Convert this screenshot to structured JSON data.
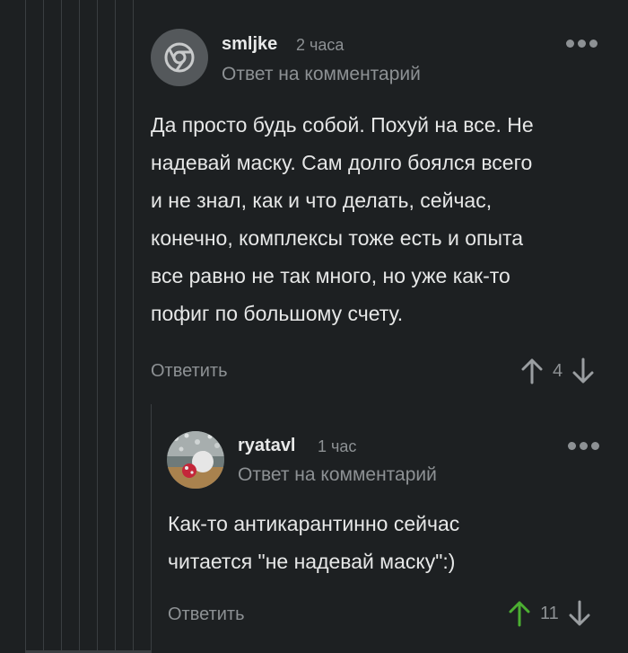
{
  "comment_main": {
    "username": "smljke",
    "time": "2 часа",
    "reply_label": "Ответ на комментарий",
    "body_lines": [
      "Да просто будь собой. Похуй на все. Не",
      "надевай маску. Сам долго боялся всего",
      "и не знал, как и что делать, сейчас,",
      "конечно, комплексы тоже есть и опыта",
      "все равно не так много, но уже как-то",
      "пофиг по большому счету."
    ],
    "reply_button": "Ответить",
    "rating": "4",
    "upvoted": false,
    "avatar": "chrome-logo-icon"
  },
  "comment_reply": {
    "username": "ryatavl",
    "time": "1 час",
    "reply_label": "Ответ на комментарий",
    "body_lines": [
      "Как-то антикарантинно сейчас",
      "читается \"не надевай маску\":)"
    ],
    "reply_button": "Ответить",
    "rating": "11",
    "upvoted": true,
    "avatar": "user-photo-avatar"
  },
  "colors": {
    "background": "#1d2022",
    "muted": "#8d9194",
    "text": "#e6e7e7",
    "upvote_active": "#4caf32",
    "thread_line": "#3a3e41"
  }
}
